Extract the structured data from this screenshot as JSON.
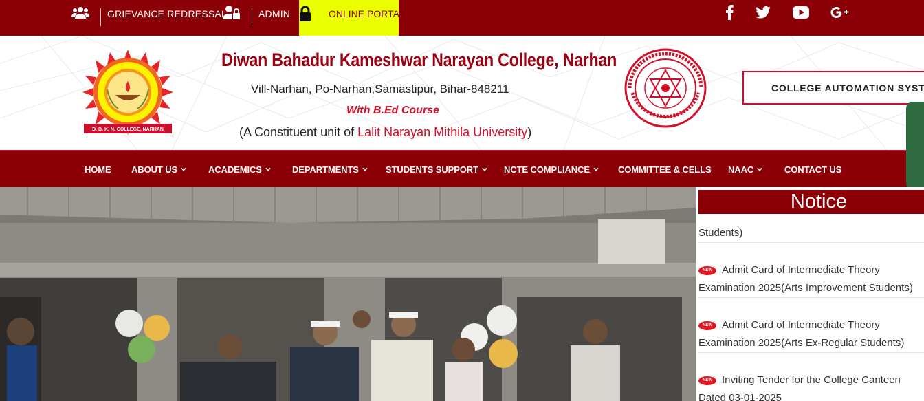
{
  "topbar": {
    "grievance": "GRIEVANCE REDRESSAL",
    "admin": "ADMIN",
    "online_portal": "ONLINE PORTAL",
    "icons": [
      "users-icon",
      "user-lock-icon",
      "lock-icon"
    ],
    "social": [
      "facebook-icon",
      "twitter-icon",
      "youtube-icon",
      "google-plus-icon"
    ]
  },
  "header": {
    "college_name": "Diwan Bahadur Kameshwar Narayan College, Narhan",
    "address": "Vill-Narhan, Po-Narhan,Samastipur, Bihar-848211",
    "course": "With B.Ed Course",
    "constituent_prefix": "(A Constituent unit of ",
    "university": "Lalit Narayan Mithila University",
    "constituent_suffix": ")",
    "logo_caption": "D. B. K. N. COLLEGE, NARHAN",
    "automation_button": "COLLEGE AUTOMATION SYSTEM"
  },
  "nav": {
    "items": [
      {
        "label": "HOME",
        "dropdown": false
      },
      {
        "label": "ABOUT US",
        "dropdown": true
      },
      {
        "label": "ACADEMICS",
        "dropdown": true
      },
      {
        "label": "DEPARTMENTS",
        "dropdown": true
      },
      {
        "label": "STUDENTS SUPPORT",
        "dropdown": true
      },
      {
        "label": "NCTE COMPLIANCE",
        "dropdown": true
      },
      {
        "label": "COMMITTEE & CELLS",
        "dropdown": false
      },
      {
        "label": "NAAC",
        "dropdown": true
      },
      {
        "label": "CONTACT US",
        "dropdown": false
      }
    ]
  },
  "notice": {
    "title": "Notice",
    "badge": "NEW",
    "fragment": "Students)",
    "items": [
      {
        "line1": "Admit Card of Intermediate Theory",
        "line2": "Examination 2025(Arts Improvement Students)"
      },
      {
        "line1": "Admit Card of Intermediate Theory",
        "line2": "Examination 2025(Arts Ex-Regular Students)"
      },
      {
        "line1": "Inviting Tender for the College Canteen",
        "line2": "Dated 03-01-2025"
      }
    ]
  },
  "colors": {
    "brand": "#8b0007",
    "accent_red": "#d4102a",
    "portal_yellow": "#eaff00"
  }
}
